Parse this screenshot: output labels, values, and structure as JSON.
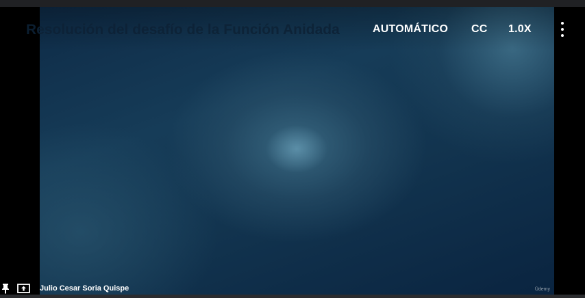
{
  "player": {
    "title": "Resolución del desafío de la Función Anidada",
    "quality_label": "AUTOMÁTICO",
    "captions_label": "CC",
    "speed_label": "1.0X",
    "more_icon": "more-vert-icon",
    "watermark": "Ūdemy"
  },
  "footer": {
    "pin_icon": "pin-icon",
    "share_icon": "upload-screen-icon",
    "user_name": "Julio Cesar Soria Quispe"
  },
  "colors": {
    "background": "#000000",
    "video_dark": "#0e2b47",
    "video_light": "#3e6e87",
    "control_text": "#ffffff"
  }
}
